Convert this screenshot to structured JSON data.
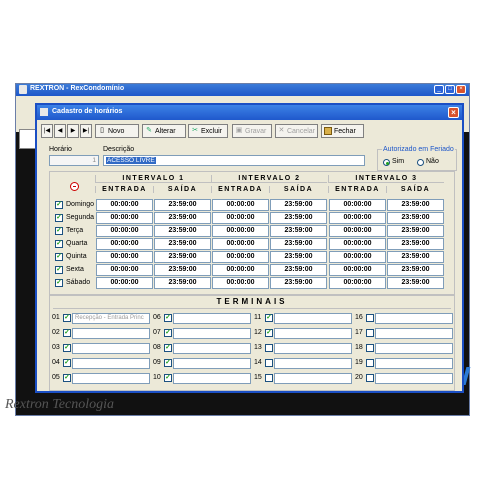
{
  "bg_window": {
    "title": "REXTRON - RexCondomínio"
  },
  "bg_logo": "Rextron Tecnologia",
  "dialog": {
    "title": "Cadastro de horários"
  },
  "toolbar": {
    "novo": "Novo",
    "alterar": "Alterar",
    "excluir": "Excluir",
    "gravar": "Gravar",
    "cancelar": "Cancelar",
    "fechar": "Fechar"
  },
  "form": {
    "horario_label": "Horário",
    "horario_value": "1",
    "descricao_label": "Descrição",
    "descricao_value": "ACESSO LIVRE",
    "feriado_label": "Autorizado em Feriado",
    "feriado_sim": "Sim",
    "feriado_nao": "Não"
  },
  "schedule": {
    "intervals": [
      "INTERVALO 1",
      "INTERVALO 2",
      "INTERVALO 3"
    ],
    "entrada": "ENTRADA",
    "saida": "SAÍDA",
    "days": [
      {
        "label": "Domingo",
        "times": [
          "00:00:00",
          "23:59:00",
          "00:00:00",
          "23:59:00",
          "00:00:00",
          "23:59:00"
        ]
      },
      {
        "label": "Segunda",
        "times": [
          "00:00:00",
          "23:59:00",
          "00:00:00",
          "23:59:00",
          "00:00:00",
          "23:59:00"
        ]
      },
      {
        "label": "Terça",
        "times": [
          "00:00:00",
          "23:59:00",
          "00:00:00",
          "23:59:00",
          "00:00:00",
          "23:59:00"
        ]
      },
      {
        "label": "Quarta",
        "times": [
          "00:00:00",
          "23:59:00",
          "00:00:00",
          "23:59:00",
          "00:00:00",
          "23:59:00"
        ]
      },
      {
        "label": "Quinta",
        "times": [
          "00:00:00",
          "23:59:00",
          "00:00:00",
          "23:59:00",
          "00:00:00",
          "23:59:00"
        ]
      },
      {
        "label": "Sexta",
        "times": [
          "00:00:00",
          "23:59:00",
          "00:00:00",
          "23:59:00",
          "00:00:00",
          "23:59:00"
        ]
      },
      {
        "label": "Sábado",
        "times": [
          "00:00:00",
          "23:59:00",
          "00:00:00",
          "23:59:00",
          "00:00:00",
          "23:59:00"
        ]
      }
    ]
  },
  "terminais": {
    "title": "TERMINAIS",
    "items": [
      {
        "num": "01",
        "checked": true,
        "text": "Recepção - Entrada Princ"
      },
      {
        "num": "02",
        "checked": true,
        "text": ""
      },
      {
        "num": "03",
        "checked": true,
        "text": ""
      },
      {
        "num": "04",
        "checked": true,
        "text": ""
      },
      {
        "num": "05",
        "checked": true,
        "text": ""
      },
      {
        "num": "06",
        "checked": true,
        "text": ""
      },
      {
        "num": "07",
        "checked": true,
        "text": ""
      },
      {
        "num": "08",
        "checked": true,
        "text": ""
      },
      {
        "num": "09",
        "checked": true,
        "text": ""
      },
      {
        "num": "10",
        "checked": true,
        "text": ""
      },
      {
        "num": "11",
        "checked": true,
        "text": ""
      },
      {
        "num": "12",
        "checked": true,
        "text": ""
      },
      {
        "num": "13",
        "checked": false,
        "text": ""
      },
      {
        "num": "14",
        "checked": false,
        "text": ""
      },
      {
        "num": "15",
        "checked": false,
        "text": ""
      },
      {
        "num": "16",
        "checked": false,
        "text": ""
      },
      {
        "num": "17",
        "checked": false,
        "text": ""
      },
      {
        "num": "18",
        "checked": false,
        "text": ""
      },
      {
        "num": "19",
        "checked": false,
        "text": ""
      },
      {
        "num": "20",
        "checked": false,
        "text": ""
      }
    ]
  }
}
